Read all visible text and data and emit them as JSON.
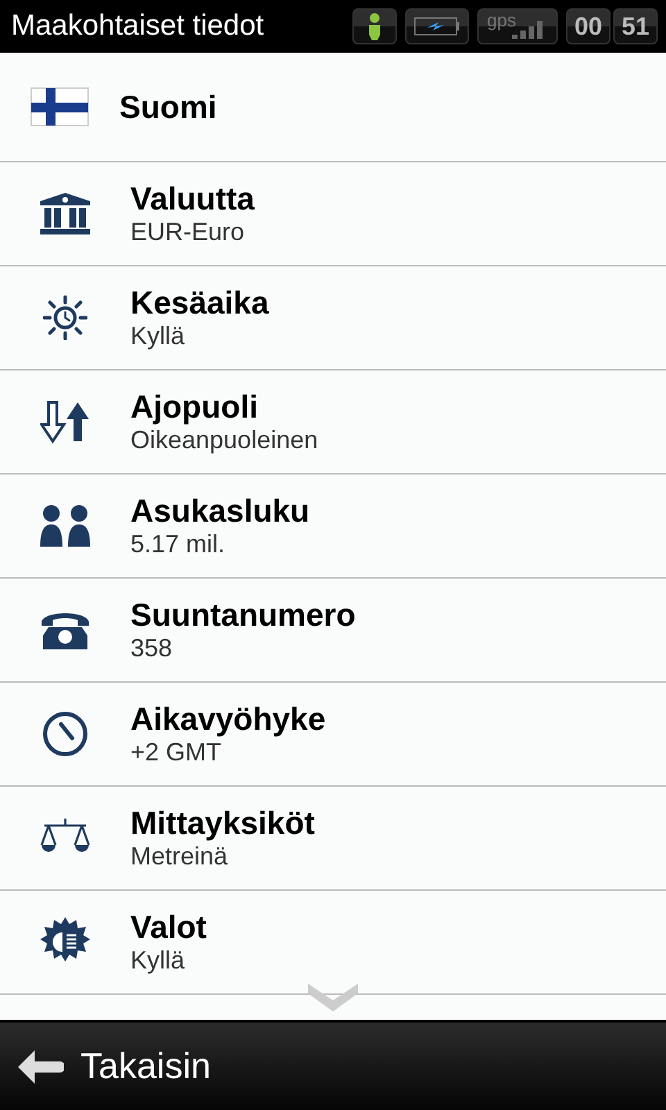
{
  "status_bar": {
    "title": "Maakohtaiset tiedot",
    "gps_label": "gps",
    "clock_hours": "00",
    "clock_minutes": "51"
  },
  "country": {
    "name": "Suomi"
  },
  "items": [
    {
      "kind": "currency",
      "label": "Valuutta",
      "value": "EUR-Euro"
    },
    {
      "kind": "dst",
      "label": "Kesäaika",
      "value": "Kyllä"
    },
    {
      "kind": "driving",
      "label": "Ajopuoli",
      "value": "Oikeanpuoleinen"
    },
    {
      "kind": "population",
      "label": "Asukasluku",
      "value": "5.17 mil."
    },
    {
      "kind": "phone",
      "label": "Suuntanumero",
      "value": "358"
    },
    {
      "kind": "timezone",
      "label": "Aikavyöhyke",
      "value": "+2 GMT"
    },
    {
      "kind": "units",
      "label": "Mittayksiköt",
      "value": "Metreinä"
    },
    {
      "kind": "lights",
      "label": "Valot",
      "value": "Kyllä"
    }
  ],
  "bottom_bar": {
    "back_label": "Takaisin"
  }
}
